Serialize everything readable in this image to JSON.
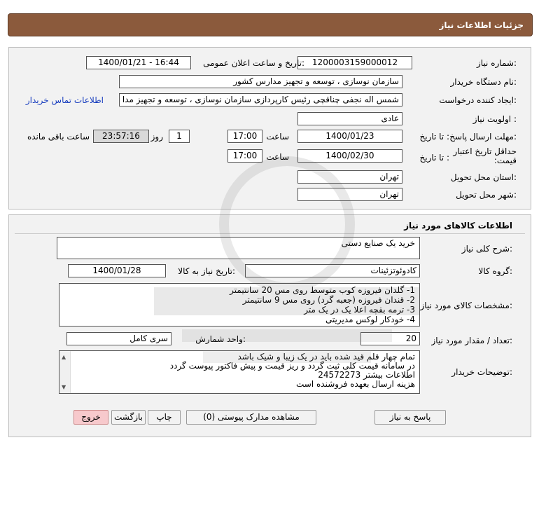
{
  "header": {
    "title": "جزئیات اطلاعات نیاز"
  },
  "info": {
    "need_number_label": "شماره نیاز:",
    "need_number": "1200003159000012",
    "announce_label": "تاریخ و ساعت اعلان عمومی:",
    "announce_value": "1400/01/21 - 16:44",
    "buyer_org_label": "نام دستگاه خریدار:",
    "buyer_org": "سازمان نوسازی ، توسعه و تجهیز مدارس کشور",
    "requester_label": "ایجاد کننده درخواست:",
    "requester": "شمس اله نجفی چناقچی رئیس کارپردازی سازمان نوسازی ، توسعه و تجهیز مدا",
    "contact_link": "اطلاعات تماس خریدار",
    "priority_label": "اولویت نیاز :",
    "priority": "عادی",
    "deadline_label": "مهلت ارسال پاسخ:",
    "until_date_label": "تا تاریخ :",
    "deadline_date": "1400/01/23",
    "time_label": "ساعت",
    "deadline_time": "17:00",
    "days_value": "1",
    "days_label": "روز و",
    "remaining_time": "23:57:16",
    "remaining_label": "ساعت باقی مانده",
    "validity_label": "حداقل تاریخ اعتبار قیمت:",
    "validity_until_label": "تا تاریخ :",
    "validity_date": "1400/02/30",
    "validity_time_label": "ساعت",
    "validity_time": "17:00",
    "province_label": "استان محل تحویل:",
    "province": "تهران",
    "city_label": "شهر محل تحویل:",
    "city": "تهران"
  },
  "goods": {
    "section_title": "اطلاعات کالاهای مورد نیاز",
    "summary_label": "شرح کلی نیاز:",
    "summary": "خرید یک صنایع دستی",
    "group_label": "گروه کالا:",
    "group": "کادوئوتزئینات",
    "need_date_label": "تاریخ نیاز به کالا:",
    "need_date": "1400/01/28",
    "specs_label": "مشخصات کالای مورد نیاز:",
    "specs": [
      "1- گلدان فیروزه کوب متوسط روی مس 20 سانتیمتر",
      "2- قندان فیروزه (جعبه گرد) روی مس 9 سانتیمتر",
      "3- ترمه بقچه اعلا یک در یک متر",
      "4- خودکار لوکس مدیریتی"
    ],
    "qty_label": "تعداد / مقدار مورد نیاز:",
    "qty": "20",
    "unit_label": "واحد شمارش:",
    "unit": "سری کامل",
    "notes_label": "توضیحات خریدار:",
    "notes": [
      "تمام چهار قلم قید شده باید در یک زیبا و شیک باشد",
      "در سامانه قیمت کلی ثبت گردد و ریز قیمت و پیش فاکتور پیوست گردد",
      "اطلاعات بیشتر 24572273",
      "هزینه ارسال بعهده فروشنده است"
    ]
  },
  "buttons": {
    "reply": "پاسخ به نیاز",
    "attachments": "مشاهده مدارک پیوستی (0)",
    "print": "چاپ",
    "back": "بازگشت",
    "exit": "خروج"
  },
  "colors": {
    "header_bg": "#8b5a3c",
    "panel_bg": "#f2f2f2",
    "link": "#1a3fbf",
    "exit_bg": "#f7c9cc"
  }
}
